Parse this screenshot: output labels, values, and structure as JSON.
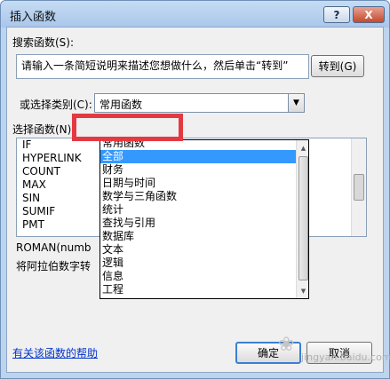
{
  "window": {
    "title": "插入函数",
    "help_label": "?",
    "close_label": "X"
  },
  "search": {
    "label": "搜索函数(S):",
    "value": "请输入一条简短说明来描述您想做什么，然后单击“转到”",
    "goto_label": "转到(G)"
  },
  "category": {
    "label": "或选择类别(C):",
    "value": "常用函数",
    "options": [
      "常用函数",
      "全部",
      "财务",
      "日期与时间",
      "数学与三角函数",
      "统计",
      "查找与引用",
      "数据库",
      "文本",
      "逻辑",
      "信息",
      "工程"
    ],
    "selected_index": 1
  },
  "functions": {
    "label": "选择函数(N):",
    "items": [
      "IF",
      "HYPERLINK",
      "COUNT",
      "MAX",
      "SIN",
      "SUMIF",
      "PMT"
    ]
  },
  "syntax": "ROMAN(numb",
  "description": "将阿拉伯数字转",
  "footer": {
    "help_link": "有关该函数的帮助",
    "ok_label": "确定",
    "cancel_label": "取消"
  },
  "watermark": {
    "icon": "paw-icon",
    "text": "jingyan.baidu.com"
  },
  "colors": {
    "highlight": "#3399ff",
    "annotation": "#e53941",
    "link": "#0033cc"
  }
}
